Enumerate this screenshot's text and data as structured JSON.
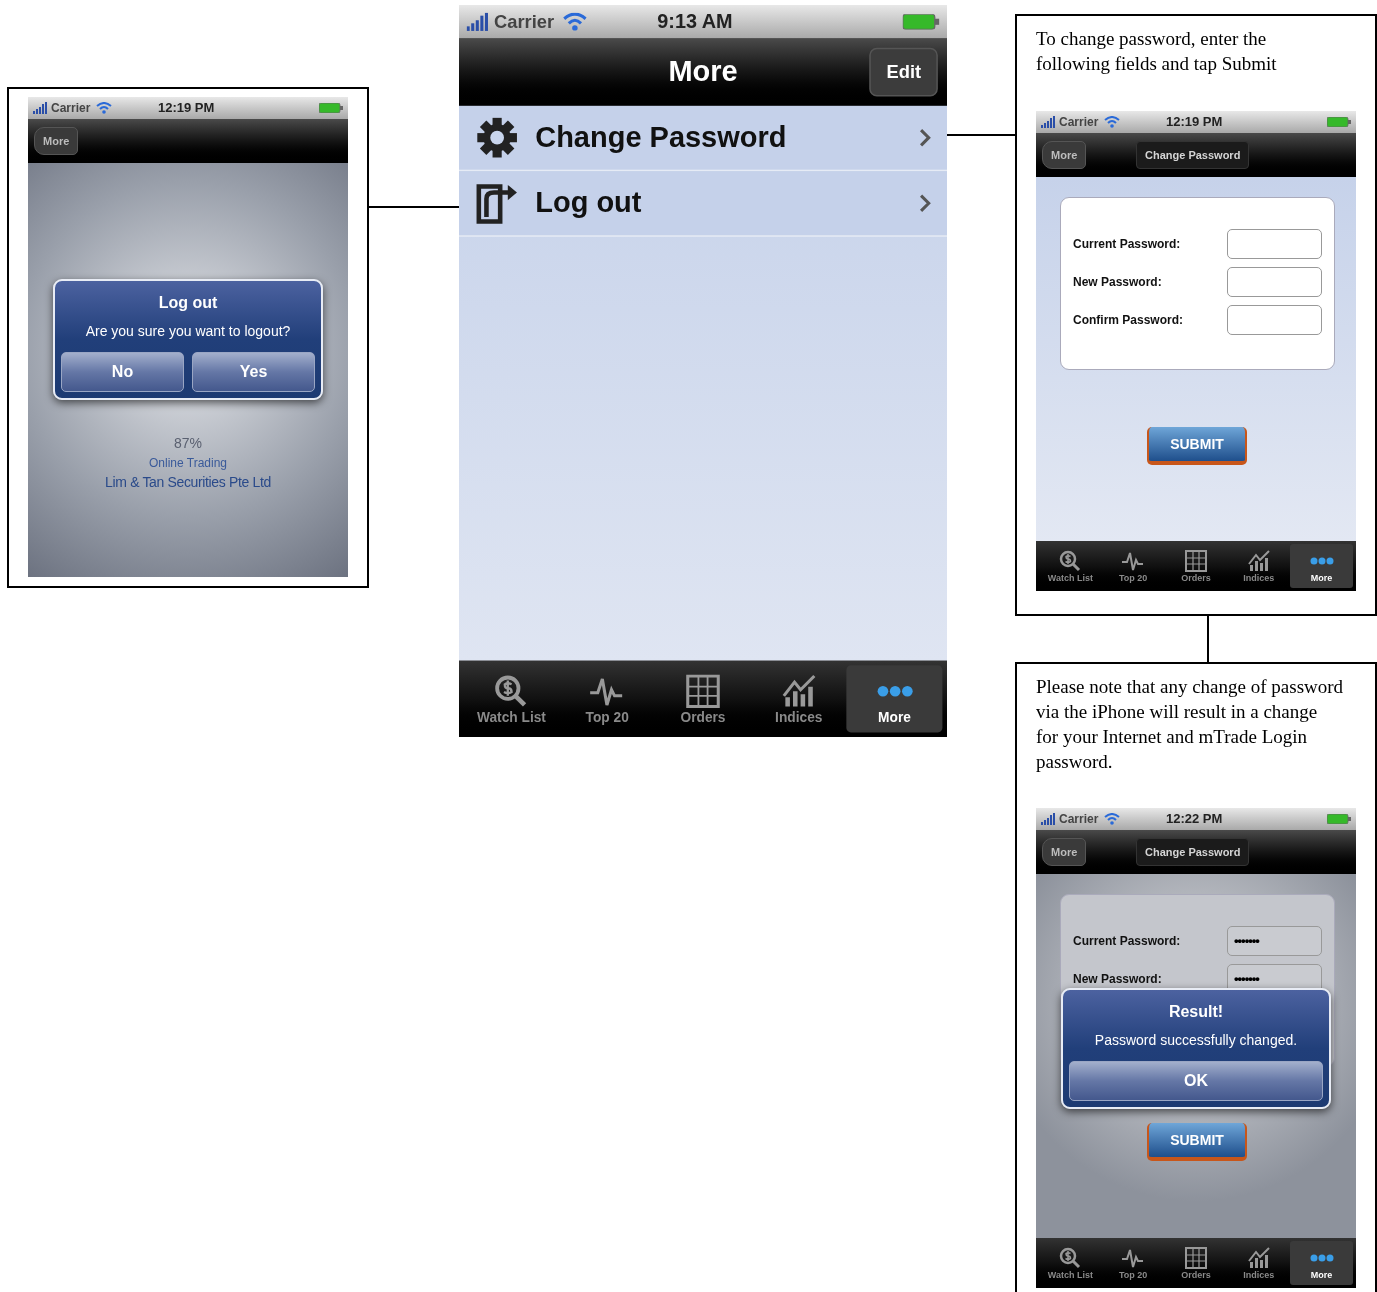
{
  "screens": [
    {
      "kind": "alert",
      "status_bar": {
        "carrier": "Carrier",
        "time": "12:19 PM"
      },
      "nav": {
        "back": "More"
      },
      "splash": {
        "progress": "87%",
        "tagline": "Online Trading",
        "company": "Lim & Tan Securities Pte Ltd"
      },
      "alert": {
        "title": "Log out",
        "message": "Are you sure you want to logout?",
        "buttons": [
          "No",
          "Yes"
        ]
      }
    },
    {
      "kind": "menu",
      "status_bar": {
        "carrier": "Carrier",
        "time": "9:13 AM"
      },
      "nav": {
        "title": "More",
        "action": "Edit"
      },
      "items": [
        {
          "label": "Change Password"
        },
        {
          "label": "Log out"
        }
      ],
      "tab_bar": [
        {
          "label": "Watch List",
          "selected": false
        },
        {
          "label": "Top 20",
          "selected": false
        },
        {
          "label": "Orders",
          "selected": false
        },
        {
          "label": "Indices",
          "selected": false
        },
        {
          "label": "More",
          "selected": true
        }
      ]
    },
    {
      "kind": "form",
      "caption": "To change password, enter the following fields and tap Submit",
      "status_bar": {
        "carrier": "Carrier",
        "time": "12:19 PM"
      },
      "nav": {
        "back": "More",
        "title": "Change Password"
      },
      "fields": [
        {
          "label": "Current Password:"
        },
        {
          "label": "New Password:"
        },
        {
          "label": "Confirm Password:"
        }
      ],
      "submit": "SUBMIT",
      "tab_bar": [
        {
          "label": "Watch List",
          "selected": false
        },
        {
          "label": "Top 20",
          "selected": false
        },
        {
          "label": "Orders",
          "selected": false
        },
        {
          "label": "Indices",
          "selected": false
        },
        {
          "label": "More",
          "selected": true
        }
      ]
    },
    {
      "kind": "form",
      "caption": "Please note that any change of password via the iPhone will result in a change for your Internet and mTrade Login password.",
      "status_bar": {
        "carrier": "Carrier",
        "time": "12:22 PM"
      },
      "nav": {
        "back": "More",
        "title": "Change Password"
      },
      "fields": [
        {
          "label": "Current Password:",
          "value": "•••••••"
        },
        {
          "label": "New Password:",
          "value": "•••••••"
        }
      ],
      "submit": "SUBMIT",
      "alert": {
        "title": "Result!",
        "message": "Password successfully changed.",
        "buttons": [
          "OK"
        ]
      },
      "tab_bar": [
        {
          "label": "Watch List",
          "selected": false
        },
        {
          "label": "Top 20",
          "selected": false
        },
        {
          "label": "Orders",
          "selected": false
        },
        {
          "label": "Indices",
          "selected": false
        },
        {
          "label": "More",
          "selected": true
        }
      ]
    }
  ]
}
